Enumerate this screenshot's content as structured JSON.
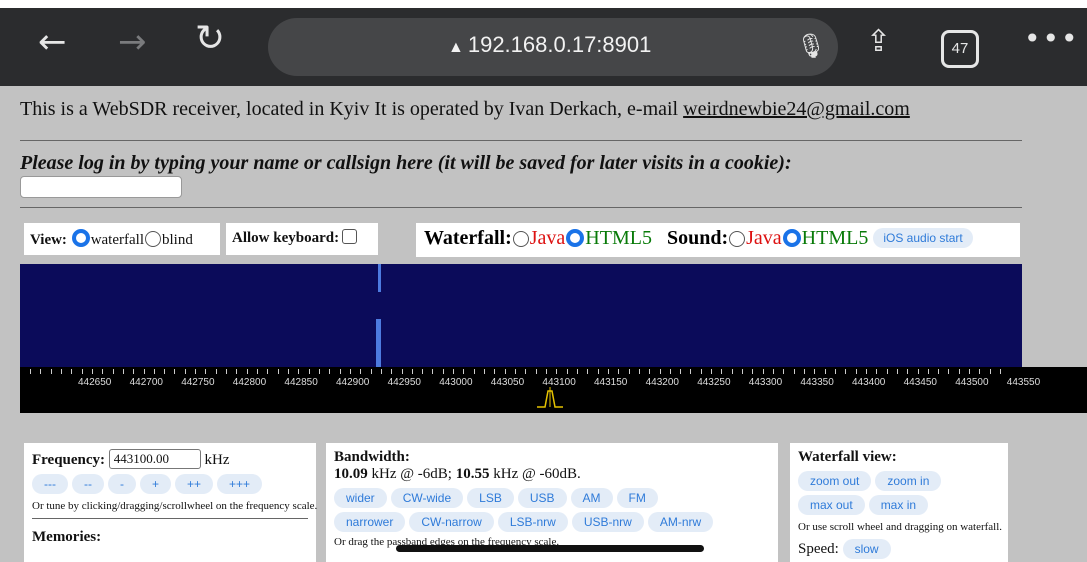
{
  "browser": {
    "url": "192.168.0.17:8901",
    "tab_count": "47"
  },
  "page": {
    "info_text": "This is a WebSDR receiver, located in Kyiv It is operated by Ivan Derkach, e-mail ",
    "email": "weirdnewbie24@gmail.com",
    "login_prompt": "Please log in by typing your name or callsign here (it will be saved for later visits in a cookie):"
  },
  "view": {
    "label": "View:",
    "option_waterfall": "waterfall",
    "option_blind": "blind",
    "selected": "waterfall"
  },
  "keyboard": {
    "label": "Allow keyboard:"
  },
  "modes": {
    "waterfall_label": "Waterfall:",
    "sound_label": "Sound:",
    "java": "Java",
    "html5": "HTML5",
    "ios_button": "iOS audio start"
  },
  "scale": {
    "ticks": [
      "442650",
      "442700",
      "442750",
      "442800",
      "442850",
      "442900",
      "442950",
      "443000",
      "443050",
      "443100",
      "443150",
      "443200",
      "443250",
      "443300",
      "443350",
      "443400",
      "443450",
      "443500",
      "443550"
    ]
  },
  "frequency": {
    "label": "Frequency:",
    "value": "443100.00",
    "unit": "kHz",
    "buttons": [
      "---",
      "--",
      "-",
      "+",
      "++",
      "+++"
    ],
    "hint": "Or tune by clicking/dragging/scrollwheel on the frequency scale.",
    "memories_label": "Memories:"
  },
  "bandwidth": {
    "label": "Bandwidth:",
    "value_6db": "10.09",
    "text_6db": " kHz @ -6dB; ",
    "value_60db": "10.55",
    "text_60db": " kHz @ -60dB.",
    "row1": [
      "wider",
      "CW-wide",
      "LSB",
      "USB",
      "AM",
      "FM"
    ],
    "row2": [
      "narrower",
      "CW-narrow",
      "LSB-nrw",
      "USB-nrw",
      "AM-nrw"
    ],
    "hint": "Or drag the passband edges on the frequency scale."
  },
  "waterfall_view": {
    "label": "Waterfall view:",
    "buttons": [
      "zoom out",
      "zoom in",
      "max out",
      "max in"
    ],
    "hint": "Or use scroll wheel and dragging on waterfall.",
    "speed_label": "Speed:",
    "speed_value": "slow"
  }
}
